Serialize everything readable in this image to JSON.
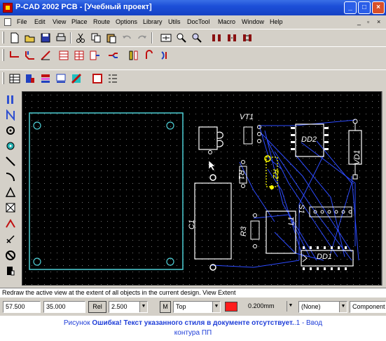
{
  "window": {
    "title": "P-CAD 2002 PCB - [Учебный проект]",
    "caption_buttons": [
      "_",
      "□",
      "×"
    ]
  },
  "menubar": {
    "items": [
      "File",
      "Edit",
      "View",
      "Place",
      "Route",
      "Options",
      "Library",
      "Utils",
      "DocTool",
      "Macro",
      "Window",
      "Help"
    ],
    "mdi_controls": [
      "_",
      "▫",
      "×"
    ]
  },
  "toolbars": {
    "row1": [
      "new-icon",
      "open-icon",
      "save-icon",
      "print-icon",
      "cut-icon",
      "copy-icon",
      "paste-icon",
      "undo-icon",
      "redo-icon",
      "view-extent-icon",
      "zoom-icon",
      "query-icon",
      "pads-icon",
      "vias-icon",
      "drc-icon"
    ],
    "row2": [
      "route-manual-icon",
      "route-bus-icon",
      "route-miter-icon",
      "route-grid-icon",
      "route-push-icon",
      "route-multi-icon",
      "route-interactive-icon",
      "route-fanout-icon",
      "route-tune-icon",
      "route-arc-icon"
    ],
    "row3": [
      "layers-icon",
      "properties-icon",
      "stack-icon",
      "display-icon",
      "colors-icon",
      "netlist-icon",
      "report-icon"
    ]
  },
  "left_tools": [
    "select-icon",
    "connect-icon",
    "place-pad-icon",
    "place-via-icon",
    "place-line-icon",
    "place-arc-icon",
    "place-polygon-icon",
    "place-copper-icon",
    "place-text-icon",
    "place-attribute-icon",
    "place-keepout-icon",
    "place-field-icon"
  ],
  "board": {
    "components": {
      "vt1": "VT1",
      "dd2": "DD2",
      "vd1": "VD1",
      "r1": "R1",
      "r2": "R2",
      "s1": "S1",
      "c1": "C1",
      "r3": "R3",
      "l1": "L1",
      "dd1": "DD1"
    }
  },
  "status_message": "Redraw the active view at the extent of all objects in the current design. View Extent",
  "statusbar": {
    "x": "57.500",
    "y": "35.000",
    "rel_label": "Rel",
    "grid": "2.500",
    "m_label": "M",
    "layer": "Top",
    "width": "0.200mm",
    "net": "(None)",
    "mode": "Component I"
  },
  "colors": {
    "titlebar": "#1c4fd8",
    "board_background": "#000000",
    "board_outline": "#4ecfd6",
    "ratsnest": "#2d4bff",
    "selected": "#ffff00",
    "layer_color": "#ff1c1c",
    "caption_text": "#1f3ed8"
  },
  "caption": {
    "prefix": "Рисунок ",
    "error": "Ошибка! Текст указанного стиля в документе отсутствует.",
    "suffix_line1": ".1 - Ввод",
    "suffix_line2": "контура ПП"
  }
}
